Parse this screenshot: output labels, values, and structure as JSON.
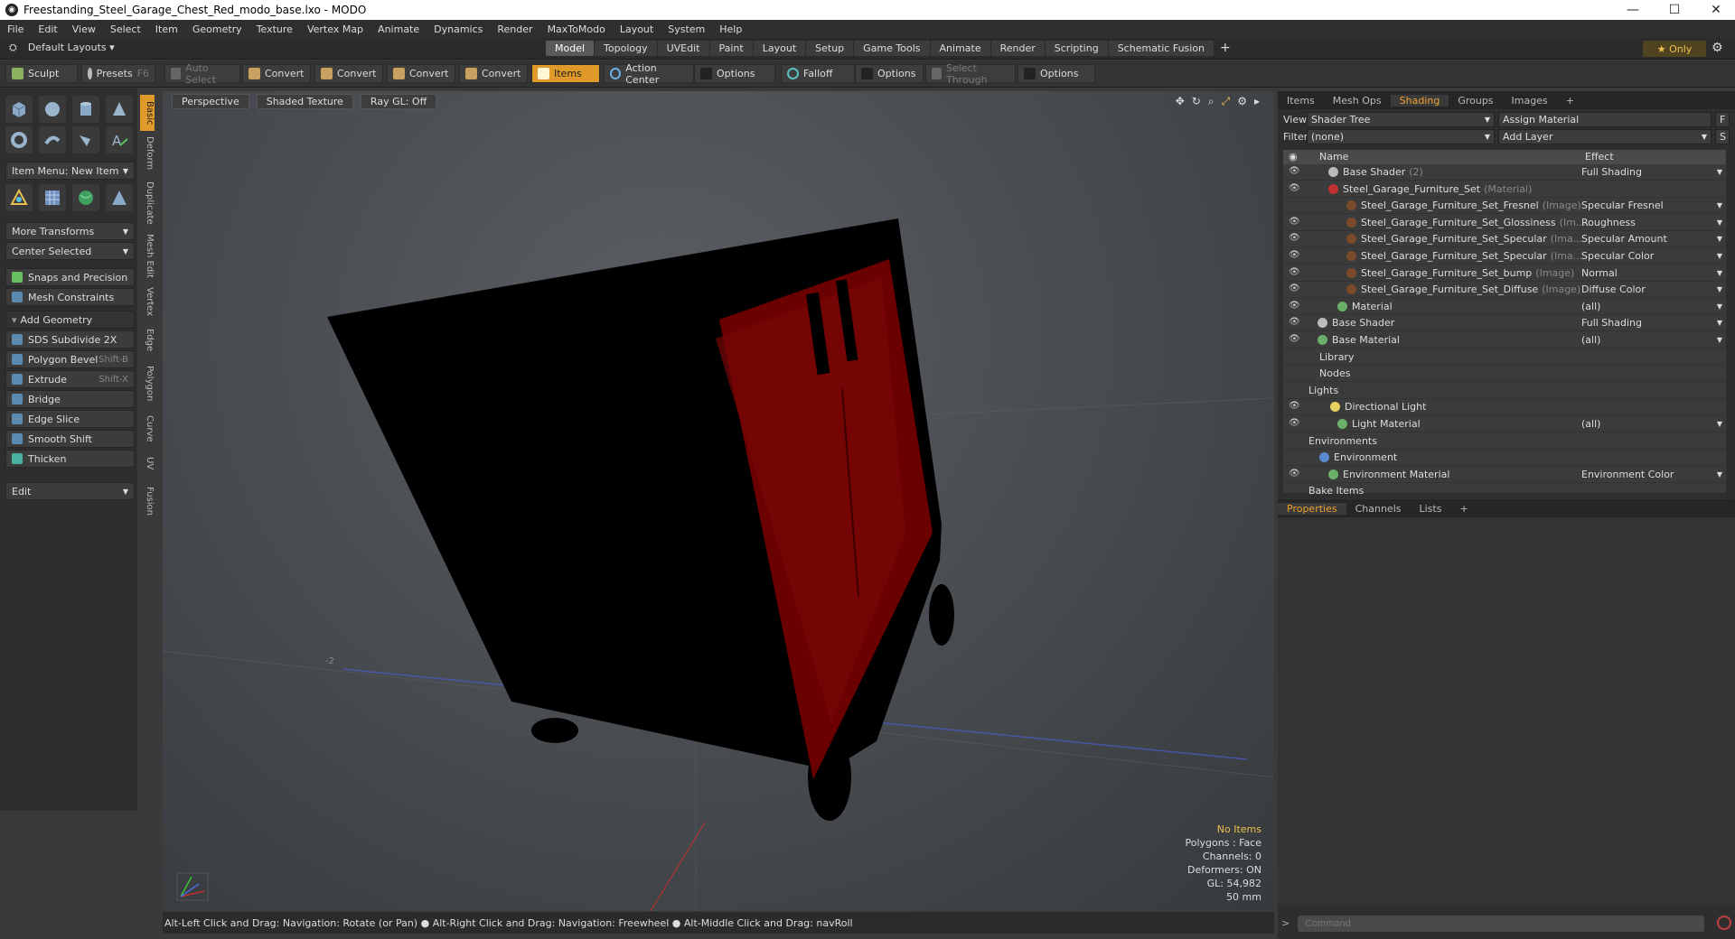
{
  "window": {
    "title": "Freestanding_Steel_Garage_Chest_Red_modo_base.lxo - MODO",
    "minimize": "—",
    "maximize": "☐",
    "close": "✕"
  },
  "menu": [
    "File",
    "Edit",
    "View",
    "Select",
    "Item",
    "Geometry",
    "Texture",
    "Vertex Map",
    "Animate",
    "Dynamics",
    "Render",
    "MaxToModo",
    "Layout",
    "System",
    "Help"
  ],
  "layouts": {
    "default_label": "Default Layouts ▾",
    "tabs": [
      "Model",
      "Topology",
      "UVEdit",
      "Paint",
      "Layout",
      "Setup",
      "Game Tools",
      "Animate",
      "Render",
      "Scripting",
      "Schematic Fusion"
    ],
    "active_tab": "Model",
    "plus": "+",
    "only_label": "★  Only"
  },
  "toolbar": {
    "sculpt": "Sculpt",
    "presets": "Presets",
    "presets_shortcut": "F6",
    "auto_select": "Auto Select",
    "convert1": "Convert",
    "convert2": "Convert",
    "convert3": "Convert",
    "convert4": "Convert",
    "items": "Items",
    "action_center": "Action Center",
    "options1": "Options",
    "falloff": "Falloff",
    "options2": "Options",
    "select_through": "Select Through",
    "options3": "Options"
  },
  "left_panel": {
    "item_menu": "Item Menu: New Item",
    "more_transforms": "More Transforms",
    "center_selected": "Center Selected",
    "snaps": "Snaps and Precision",
    "mesh_constraints": "Mesh Constraints",
    "add_geometry": "Add Geometry",
    "tools": [
      {
        "label": "SDS Subdivide 2X",
        "shortcut": ""
      },
      {
        "label": "Polygon Bevel",
        "shortcut": "Shift-B"
      },
      {
        "label": "Extrude",
        "shortcut": "Shift-X"
      },
      {
        "label": "Bridge",
        "shortcut": ""
      },
      {
        "label": "Edge Slice",
        "shortcut": ""
      },
      {
        "label": "Smooth Shift",
        "shortcut": ""
      },
      {
        "label": "Thicken",
        "shortcut": ""
      }
    ],
    "edit": "Edit",
    "vertical_tabs": [
      "Basic",
      "Deform",
      "Duplicate",
      "Mesh Edit",
      "Vertex",
      "Edge",
      "Polygon",
      "Curve",
      "UV",
      "Fusion"
    ]
  },
  "viewport": {
    "perspective": "Perspective",
    "shaded_texture": "Shaded Texture",
    "ray_gl": "Ray GL: Off",
    "grid_label": "-2",
    "info": {
      "no_items": "No Items",
      "polygons": "Polygons : Face",
      "channels": "Channels: 0",
      "deformers": "Deformers: ON",
      "gl": "GL: 54,982",
      "mm": "50 mm"
    }
  },
  "status": "Alt-Left Click and Drag: Navigation: Rotate (or Pan) ● Alt-Right Click and Drag: Navigation: Freewheel ● Alt-Middle Click and Drag: navRoll",
  "right_panel": {
    "tabs": [
      "Items",
      "Mesh Ops",
      "Shading",
      "Groups",
      "Images",
      "+"
    ],
    "active_tab": "Shading",
    "view_label": "View",
    "view_value": "Shader Tree",
    "assign_material": "Assign Material",
    "filter_label": "Filter",
    "filter_value": "(none)",
    "add_layer": "Add Layer",
    "f_btn": "F",
    "s_btn": "S",
    "col_name": "Name",
    "col_effect": "Effect",
    "rows": [
      {
        "name": "Base Shader",
        "tag": "(2)",
        "effect": "Full Shading",
        "indent": 50,
        "ball": "#bbbbbb",
        "eye": true
      },
      {
        "name": "Steel_Garage_Furniture_Set",
        "tag": "(Material)",
        "effect": "",
        "indent": 50,
        "ball": "#c03030",
        "eye": true
      },
      {
        "name": "Steel_Garage_Furniture_Set_Fresnel",
        "tag": "(Image)",
        "effect": "Specular Fresnel",
        "indent": 70,
        "ball": "#7a4a2a",
        "eye": false
      },
      {
        "name": "Steel_Garage_Furniture_Set_Glossiness",
        "tag": "(Im...",
        "effect": "Roughness",
        "indent": 70,
        "ball": "#7a4a2a",
        "eye": true
      },
      {
        "name": "Steel_Garage_Furniture_Set_Specular",
        "tag": "(Ima...",
        "effect": "Specular Amount",
        "indent": 70,
        "ball": "#7a4a2a",
        "eye": true
      },
      {
        "name": "Steel_Garage_Furniture_Set_Specular",
        "tag": "(Ima...",
        "effect": "Specular Color",
        "indent": 70,
        "ball": "#7a4a2a",
        "eye": true
      },
      {
        "name": "Steel_Garage_Furniture_Set_bump",
        "tag": "(Image)",
        "effect": "Normal",
        "indent": 70,
        "ball": "#7a4a2a",
        "eye": true
      },
      {
        "name": "Steel_Garage_Furniture_Set_Diffuse",
        "tag": "(Image)",
        "effect": "Diffuse Color",
        "indent": 70,
        "ball": "#7a4a2a",
        "eye": true
      },
      {
        "name": "Material",
        "tag": "",
        "effect": "(all)",
        "indent": 60,
        "ball": "#6ab06a",
        "eye": true
      },
      {
        "name": "Base Shader",
        "tag": "",
        "effect": "Full Shading",
        "indent": 38,
        "ball": "#bbbbbb",
        "eye": true
      },
      {
        "name": "Base Material",
        "tag": "",
        "effect": "(all)",
        "indent": 38,
        "ball": "#6ab06a",
        "eye": true
      },
      {
        "name": "Library",
        "tag": "",
        "effect": "",
        "indent": 40,
        "ball": "",
        "eye": false
      },
      {
        "name": "Nodes",
        "tag": "",
        "effect": "",
        "indent": 40,
        "ball": "",
        "eye": false
      },
      {
        "name": "Lights",
        "tag": "",
        "effect": "",
        "indent": 28,
        "ball": "",
        "eye": false
      },
      {
        "name": "Directional Light",
        "tag": "",
        "effect": "",
        "indent": 52,
        "ball": "#e8d060",
        "eye": true
      },
      {
        "name": "Light Material",
        "tag": "",
        "effect": "(all)",
        "indent": 60,
        "ball": "#6ab06a",
        "eye": true
      },
      {
        "name": "Environments",
        "tag": "",
        "effect": "",
        "indent": 28,
        "ball": "",
        "eye": false
      },
      {
        "name": "Environment",
        "tag": "",
        "effect": "",
        "indent": 40,
        "ball": "#5a8ad0",
        "eye": false
      },
      {
        "name": "Environment Material",
        "tag": "",
        "effect": "Environment Color",
        "indent": 50,
        "ball": "#6ab06a",
        "eye": true
      },
      {
        "name": "Bake Items",
        "tag": "",
        "effect": "",
        "indent": 28,
        "ball": "",
        "eye": false
      }
    ],
    "prop_tabs": [
      "Properties",
      "Channels",
      "Lists",
      "+"
    ],
    "active_prop_tab": "Properties",
    "command_placeholder": "Command"
  }
}
